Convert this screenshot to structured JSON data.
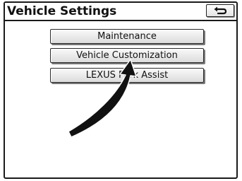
{
  "header": {
    "title": "Vehicle Settings",
    "back_icon": "return-arrow-icon"
  },
  "menu": {
    "items": [
      {
        "label": "Maintenance"
      },
      {
        "label": "Vehicle Customization"
      },
      {
        "label": "LEXUS Park Assist"
      }
    ]
  },
  "annotation": {
    "pointer_icon": "curved-arrow-icon",
    "color": "#111111"
  }
}
